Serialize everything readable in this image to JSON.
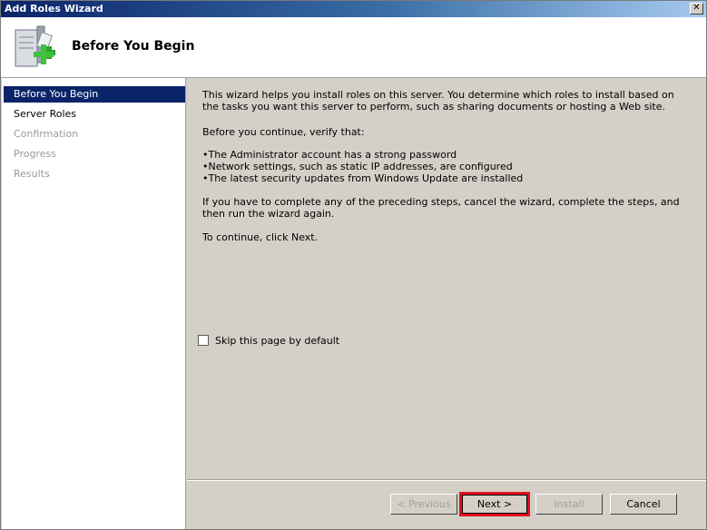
{
  "window": {
    "title": "Add Roles Wizard",
    "close_glyph": "✕"
  },
  "header": {
    "title": "Before You Begin",
    "icon": "server-add-icon"
  },
  "sidebar": {
    "items": [
      {
        "label": "Before You Begin",
        "state": "active"
      },
      {
        "label": "Server Roles",
        "state": "normal"
      },
      {
        "label": "Confirmation",
        "state": "disabled"
      },
      {
        "label": "Progress",
        "state": "disabled"
      },
      {
        "label": "Results",
        "state": "disabled"
      }
    ]
  },
  "content": {
    "intro": "This wizard helps you install roles on this server. You determine which roles to install based on the tasks you want this server to perform, such as sharing documents or hosting a Web site.",
    "verify": "Before you continue, verify that:",
    "bullets": [
      "The Administrator account has a strong password",
      "Network settings, such as static IP addresses, are configured",
      "The latest security updates from Windows Update are installed"
    ],
    "bullet_glyph": "•",
    "preceding": "If you have to complete any of the preceding steps, cancel the wizard, complete the steps, and then run the wizard again.",
    "continue": "To continue, click Next.",
    "skip_label": "Skip this page by default"
  },
  "buttons": {
    "previous": "< Previous",
    "next": "Next >",
    "install": "Install",
    "cancel": "Cancel"
  },
  "colors": {
    "selection": "#0a246a",
    "highlight_border": "#e0101f"
  }
}
